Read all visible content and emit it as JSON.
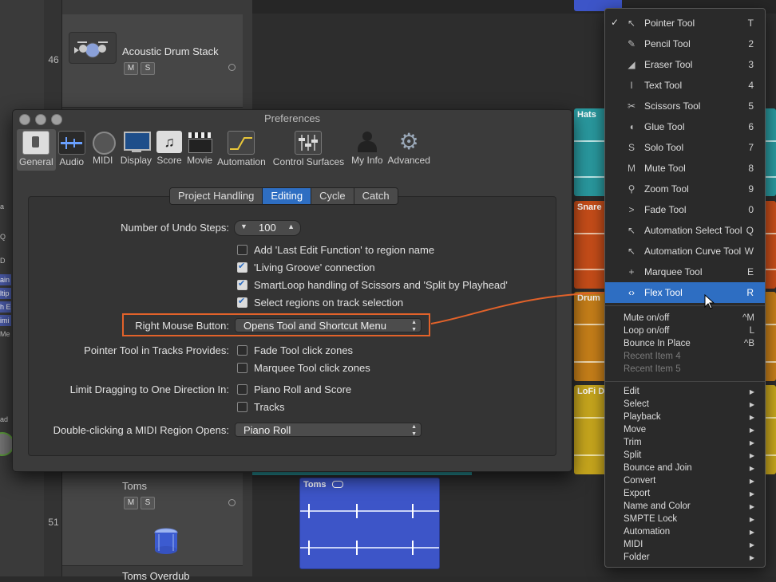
{
  "tracks": [
    {
      "number": "46",
      "name": "Acoustic Drum Stack",
      "mute": "M",
      "solo": "S"
    },
    {
      "number": "51",
      "name": "Toms",
      "mute": "M",
      "solo": "S"
    },
    {
      "number": "",
      "name": "Toms Overdub",
      "mute": "",
      "solo": ""
    }
  ],
  "left_strip_labels": [
    "a M",
    "Q",
    "D",
    "ain",
    "ltip",
    "h E",
    "imi",
    "Me",
    "ad"
  ],
  "regions": [
    {
      "label": "Hats",
      "color": "#2a9aa0"
    },
    {
      "label": "Snare",
      "color": "#c84e1a"
    },
    {
      "label": "Drum",
      "color": "#c8801a"
    },
    {
      "label": "LoFi D",
      "color": "#c9a81e"
    },
    {
      "label": "Toms",
      "color": "#3d55c8"
    }
  ],
  "preferences": {
    "title": "Preferences",
    "toolbar": [
      {
        "label": "General",
        "icon": "general-switch-icon"
      },
      {
        "label": "Audio",
        "icon": "audio-waveform-icon"
      },
      {
        "label": "MIDI",
        "icon": "midi-port-icon"
      },
      {
        "label": "Display",
        "icon": "display-monitor-icon"
      },
      {
        "label": "Score",
        "icon": "score-notes-icon"
      },
      {
        "label": "Movie",
        "icon": "movie-clapper-icon"
      },
      {
        "label": "Automation",
        "icon": "automation-curve-icon"
      },
      {
        "label": "Control Surfaces",
        "icon": "control-surfaces-fader-icon"
      },
      {
        "label": "My Info",
        "icon": "my-info-person-icon"
      },
      {
        "label": "Advanced",
        "icon": "advanced-gear-icon"
      }
    ],
    "tabs": [
      "Project Handling",
      "Editing",
      "Cycle",
      "Catch"
    ],
    "active_tab": "Editing",
    "undo_steps_label": "Number of Undo Steps:",
    "undo_steps_value": "100",
    "checkboxes_top": [
      {
        "label": "Add 'Last Edit Function' to region name",
        "checked": false
      },
      {
        "label": "'Living Groove' connection",
        "checked": true
      },
      {
        "label": "SmartLoop handling of Scissors and 'Split by Playhead'",
        "checked": true
      },
      {
        "label": "Select regions on track selection",
        "checked": true
      }
    ],
    "right_mouse_label": "Right Mouse Button:",
    "right_mouse_value": "Opens Tool and Shortcut Menu",
    "pointer_tool_label": "Pointer Tool in Tracks Provides:",
    "pointer_tool_options": [
      {
        "label": "Fade Tool click zones",
        "checked": false
      },
      {
        "label": "Marquee Tool click zones",
        "checked": false
      }
    ],
    "limit_drag_label": "Limit Dragging to One Direction In:",
    "limit_drag_options": [
      {
        "label": "Piano Roll and Score",
        "checked": false
      },
      {
        "label": "Tracks",
        "checked": false
      }
    ],
    "double_click_label": "Double-clicking a MIDI Region Opens:",
    "double_click_value": "Piano Roll",
    "highlight_color": "#e2622a"
  },
  "menu": {
    "tools": [
      {
        "label": "Pointer Tool",
        "shortcut": "T",
        "icon": "pointer-arrow-icon",
        "glyph": "↖",
        "checked": true
      },
      {
        "label": "Pencil Tool",
        "shortcut": "2",
        "icon": "pencil-icon",
        "glyph": "✎"
      },
      {
        "label": "Eraser Tool",
        "shortcut": "3",
        "icon": "eraser-icon",
        "glyph": "◢"
      },
      {
        "label": "Text Tool",
        "shortcut": "4",
        "icon": "text-cursor-icon",
        "glyph": "I"
      },
      {
        "label": "Scissors Tool",
        "shortcut": "5",
        "icon": "scissors-icon",
        "glyph": "✂"
      },
      {
        "label": "Glue Tool",
        "shortcut": "6",
        "icon": "glue-icon",
        "glyph": "◖"
      },
      {
        "label": "Solo Tool",
        "shortcut": "7",
        "icon": "solo-s-icon",
        "glyph": "S"
      },
      {
        "label": "Mute Tool",
        "shortcut": "8",
        "icon": "mute-m-icon",
        "glyph": "M"
      },
      {
        "label": "Zoom Tool",
        "shortcut": "9",
        "icon": "zoom-magnifier-icon",
        "glyph": "⚲"
      },
      {
        "label": "Fade Tool",
        "shortcut": "0",
        "icon": "fade-icon",
        "glyph": ">"
      },
      {
        "label": "Automation Select Tool",
        "shortcut": "Q",
        "icon": "automation-select-icon",
        "glyph": "↖"
      },
      {
        "label": "Automation Curve Tool",
        "shortcut": "W",
        "icon": "automation-curve-icon",
        "glyph": "↖"
      },
      {
        "label": "Marquee Tool",
        "shortcut": "E",
        "icon": "marquee-crosshair-icon",
        "glyph": "+"
      },
      {
        "label": "Flex Tool",
        "shortcut": "R",
        "icon": "flex-arrows-icon",
        "glyph": "‹›",
        "selected": true
      }
    ],
    "shortcuts": [
      {
        "label": "Mute on/off",
        "shortcut": "^M",
        "disabled": false
      },
      {
        "label": "Loop on/off",
        "shortcut": "L",
        "disabled": false
      },
      {
        "label": "Bounce In Place",
        "shortcut": "^B",
        "disabled": false
      },
      {
        "label": "Recent Item 4",
        "shortcut": "",
        "disabled": true
      },
      {
        "label": "Recent Item 5",
        "shortcut": "",
        "disabled": true
      }
    ],
    "submenus": [
      "Edit",
      "Select",
      "Playback",
      "Move",
      "Trim",
      "Split",
      "Bounce and Join",
      "Convert",
      "Export",
      "Name and Color",
      "SMPTE Lock",
      "Automation",
      "MIDI",
      "Folder"
    ],
    "submenu_arrow": "▶",
    "check_glyph": "✓",
    "selection_color": "#2e6ec2"
  }
}
